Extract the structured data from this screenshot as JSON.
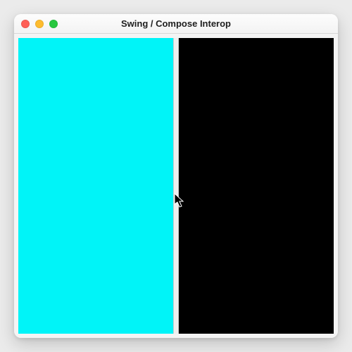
{
  "window": {
    "title": "Swing / Compose Interop",
    "controls": {
      "close": "close",
      "minimize": "minimize",
      "maximize": "maximize"
    }
  },
  "panels": {
    "left_color": "#00f4f8",
    "right_color": "#000000"
  }
}
